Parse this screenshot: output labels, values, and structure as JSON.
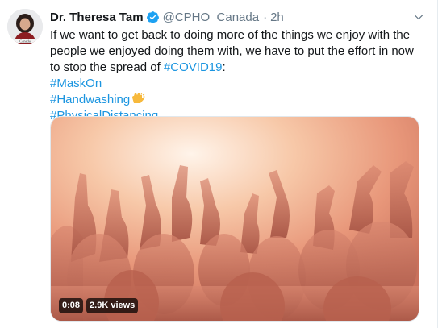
{
  "tweet": {
    "author_name": "Dr. Theresa Tam",
    "handle": "@CPHO_Canada",
    "separator": "·",
    "timestamp": "2h",
    "avatar_caption": "Canada",
    "text_main": "If we want to get back to doing more of the things we enjoy with the people we enjoyed doing them with, we have to put the effort in now to stop the spread of ",
    "inline_hashtag": "#COVID19",
    "inline_suffix": ":",
    "hashtags": [
      "#MaskOn",
      "#Handwashing",
      "#PhysicalDistancing"
    ]
  },
  "video": {
    "duration": "0:08",
    "views": "2.9K views"
  },
  "colors": {
    "link": "#1b95e0",
    "secondary_text": "#657786",
    "verified": "#1da1f2"
  },
  "icons": {
    "verified": "verified-badge-icon",
    "more": "chevron-down-icon",
    "emoji": "clapping-hands-icon"
  }
}
